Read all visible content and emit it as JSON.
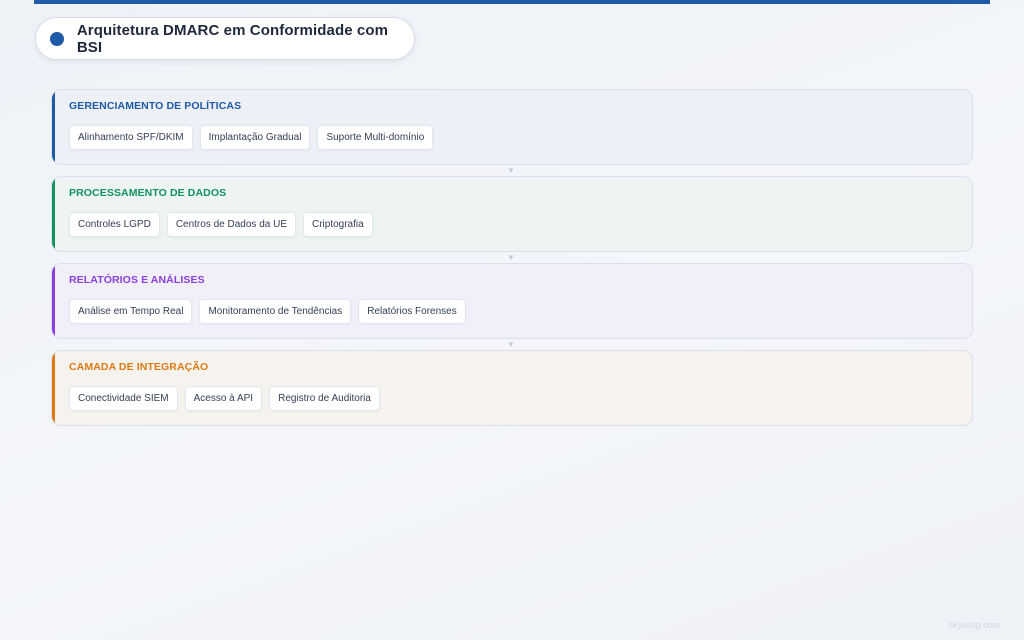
{
  "page": {
    "title": "Arquitetura DMARC em Conformidade com BSI",
    "accent_color": "#1f5aa6",
    "watermark": "skywiog.com"
  },
  "layers": [
    {
      "title": "GERENCIAMENTO DE POLÍTICAS",
      "color": "#1f5aa6",
      "background": "#edf1f7",
      "items": [
        "Alinhamento SPF/DKIM",
        "Implantação Gradual",
        "Suporte Multi-domínio"
      ]
    },
    {
      "title": "PROCESSAMENTO DE DADOS",
      "color": "#12935e",
      "background": "#edf4f3",
      "items": [
        "Controles LGPD",
        "Centros de Dados da UE",
        "Criptografia"
      ]
    },
    {
      "title": "RELATÓRIOS E ANÁLISES",
      "color": "#8a3fe0",
      "background": "#f1f0fa",
      "items": [
        "Análise em Tempo Real",
        "Monitoramento de Tendências",
        "Relatórios Forenses"
      ]
    },
    {
      "title": "CAMADA DE INTEGRAÇÃO",
      "color": "#dd7a12",
      "background": "#f6f3ef",
      "items": [
        "Conectividade SIEM",
        "Acesso à API",
        "Registro de Auditoria"
      ]
    }
  ],
  "connector_icon": "arrow-down-icon"
}
